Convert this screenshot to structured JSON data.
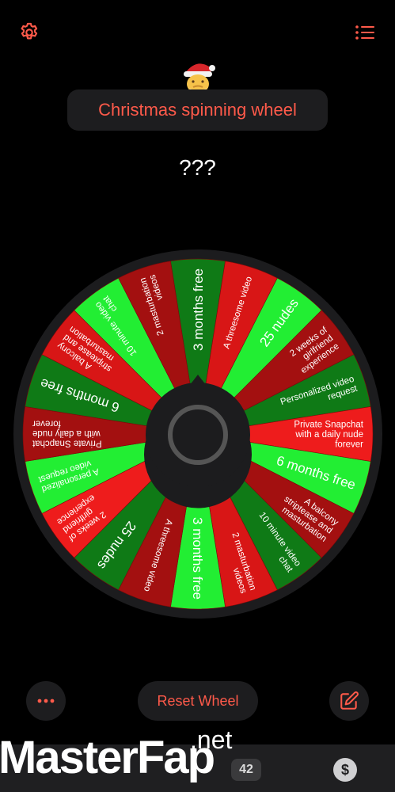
{
  "header": {
    "title": "Christmas spinning wheel",
    "result": "???"
  },
  "icons": {
    "settings": "gear-icon",
    "menu": "list-icon",
    "avatar": "santa-emoji-icon",
    "more": "ellipsis-icon",
    "edit": "edit-icon",
    "dollar": "dollar-icon"
  },
  "colors": {
    "accent": "#ff5a4a",
    "green_bright": "#22ee33",
    "green_dark": "#0f7a16",
    "red_dark": "#a31010",
    "red_bright": "#ee1c1c"
  },
  "wheel": {
    "segments": [
      {
        "label": "3 months free",
        "color": "#0f7a16"
      },
      {
        "label": "A threesome video",
        "color": "#d81616"
      },
      {
        "label": "25 nudes",
        "color": "#22ee33"
      },
      {
        "label": "2 weeks of girlfriend experience",
        "color": "#a31010"
      },
      {
        "label": "Personalized video request",
        "color": "#0f7a16"
      },
      {
        "label": "Private Snapchat with a daily nude forever",
        "color": "#ee1c1c"
      },
      {
        "label": "6 months free",
        "color": "#22ee33"
      },
      {
        "label": "A balcony striptease and masturbation",
        "color": "#a31010"
      },
      {
        "label": "10 minute video chat",
        "color": "#0f7a16"
      },
      {
        "label": "2 masturbation videos",
        "color": "#d81616"
      },
      {
        "label": "3 months free",
        "color": "#22ee33"
      },
      {
        "label": "A threesome video",
        "color": "#a31010"
      },
      {
        "label": "25 nudes",
        "color": "#0f7a16"
      },
      {
        "label": "2 weeks of girlfriend experience",
        "color": "#ee1c1c"
      },
      {
        "label": "A personalized video request",
        "color": "#22ee33"
      },
      {
        "label": "Private Snapchat with a daily nude forever",
        "color": "#a31010"
      },
      {
        "label": "6 months free",
        "color": "#0f7a16"
      },
      {
        "label": "A balcony striptease and masturbation",
        "color": "#d81616"
      },
      {
        "label": "10 minute video chat",
        "color": "#22ee33"
      },
      {
        "label": "2 masturbation videos",
        "color": "#a31010"
      }
    ]
  },
  "footer": {
    "reset_label": "Reset Wheel"
  },
  "bottom_bar": {
    "badge": "42",
    "dollar": "$"
  },
  "watermark": {
    "main": "MasterFap",
    "suffix": ".net"
  }
}
